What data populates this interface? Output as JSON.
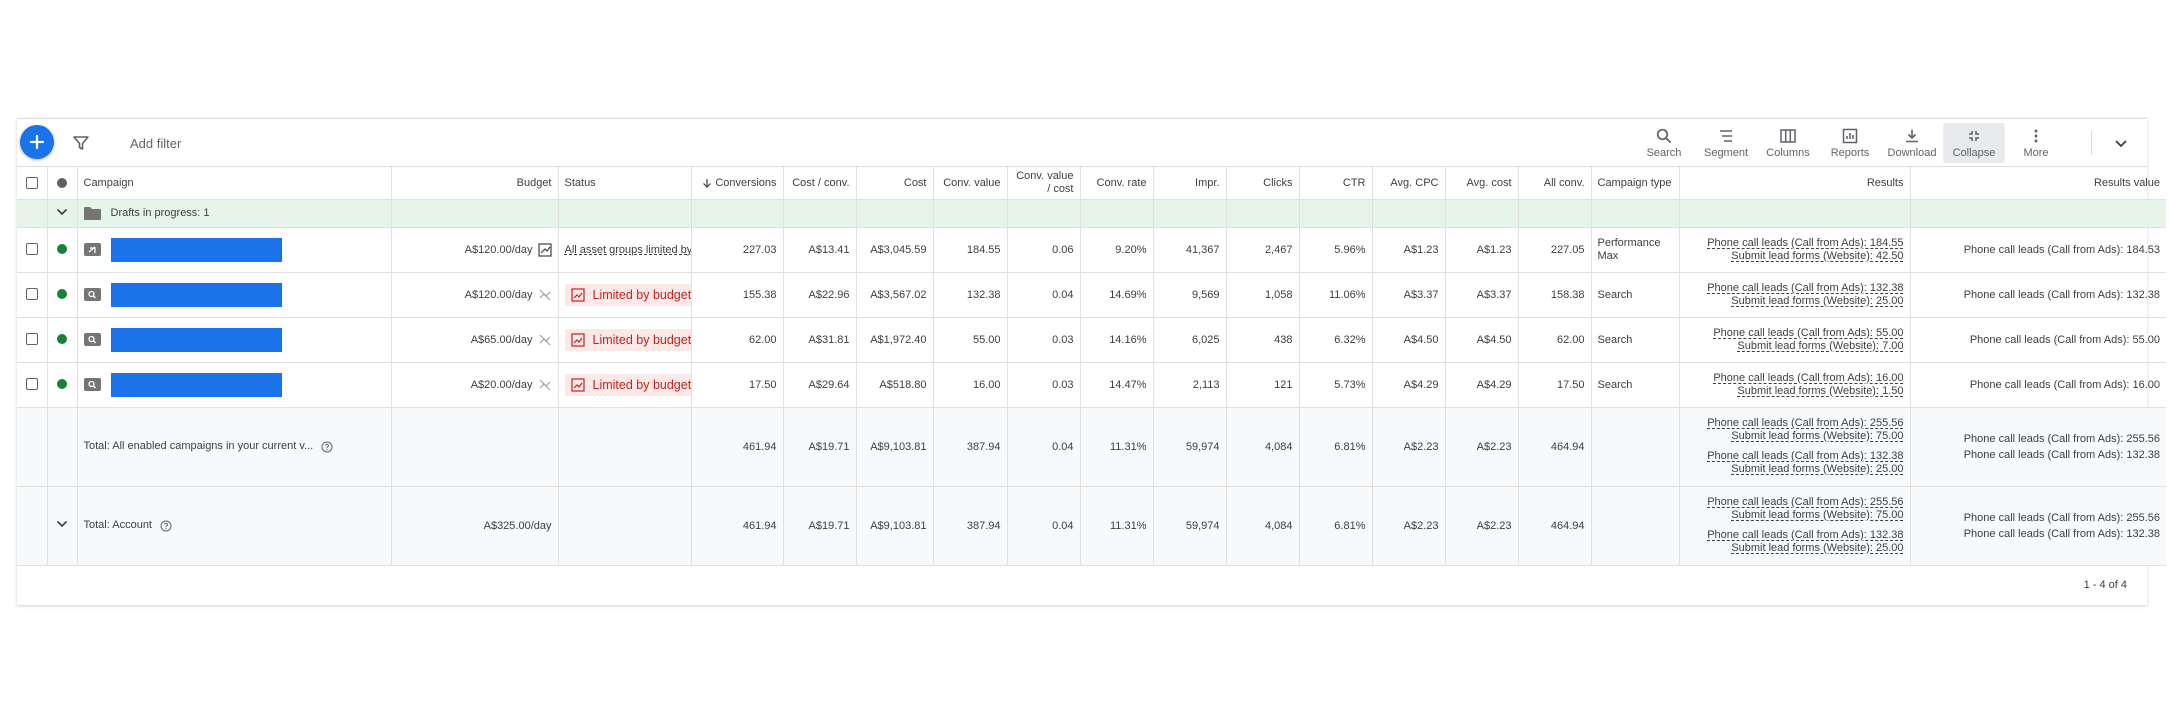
{
  "toolbar": {
    "add_filter": "Add filter",
    "tools": [
      {
        "label": "Search",
        "icon": "search-icon"
      },
      {
        "label": "Segment",
        "icon": "segment-icon"
      },
      {
        "label": "Columns",
        "icon": "columns-icon"
      },
      {
        "label": "Reports",
        "icon": "reports-icon"
      },
      {
        "label": "Download",
        "icon": "download-icon"
      },
      {
        "label": "Collapse",
        "icon": "collapse-icon"
      },
      {
        "label": "More",
        "icon": "more-vert-icon"
      }
    ]
  },
  "columns": {
    "campaign": "Campaign",
    "budget": "Budget",
    "status": "Status",
    "conversions": "Conversions",
    "cost_conv": "Cost / conv.",
    "cost": "Cost",
    "conv_value": "Conv. value",
    "conv_value_cost_1": "Conv. value",
    "conv_value_cost_2": "/ cost",
    "conv_rate": "Conv. rate",
    "impr": "Impr.",
    "clicks": "Clicks",
    "ctr": "CTR",
    "avg_cpc": "Avg. CPC",
    "avg_cost": "Avg. cost",
    "all_conv": "All conv.",
    "campaign_type": "Campaign type",
    "results": "Results",
    "results_value": "Results value"
  },
  "draft": {
    "label": "Drafts in progress: 1"
  },
  "rows": [
    {
      "budget": "A$120.00/day",
      "status": "All asset groups limited by bid strategy",
      "conversions": "227.03",
      "cost_conv": "A$13.41",
      "cost": "A$3,045.59",
      "conv_value": "184.55",
      "conv_value_cost": "0.06",
      "conv_rate": "9.20%",
      "impr": "41,367",
      "clicks": "2,467",
      "ctr": "5.96%",
      "avg_cpc": "A$1.23",
      "avg_cost": "A$1.23",
      "all_conv": "227.05",
      "type_1": "Performance",
      "type_2": "Max",
      "results_1": "Phone call leads (Call from Ads): 184.55",
      "results_2": "Submit lead forms (Website): 42.50",
      "results_value": "Phone call leads (Call from Ads): 184.53"
    },
    {
      "budget": "A$120.00/day",
      "status": "Limited by budget",
      "conversions": "155.38",
      "cost_conv": "A$22.96",
      "cost": "A$3,567.02",
      "conv_value": "132.38",
      "conv_value_cost": "0.04",
      "conv_rate": "14.69%",
      "impr": "9,569",
      "clicks": "1,058",
      "ctr": "11.06%",
      "avg_cpc": "A$3.37",
      "avg_cost": "A$3.37",
      "all_conv": "158.38",
      "type_1": "Search",
      "results_1": "Phone call leads (Call from Ads): 132.38",
      "results_2": "Submit lead forms (Website): 25.00",
      "results_value": "Phone call leads (Call from Ads): 132.38"
    },
    {
      "budget": "A$65.00/day",
      "status": "Limited by budget",
      "conversions": "62.00",
      "cost_conv": "A$31.81",
      "cost": "A$1,972.40",
      "conv_value": "55.00",
      "conv_value_cost": "0.03",
      "conv_rate": "14.16%",
      "impr": "6,025",
      "clicks": "438",
      "ctr": "6.32%",
      "avg_cpc": "A$4.50",
      "avg_cost": "A$4.50",
      "all_conv": "62.00",
      "type_1": "Search",
      "results_1": "Phone call leads (Call from Ads): 55.00",
      "results_2": "Submit lead forms (Website): 7.00",
      "results_value": "Phone call leads (Call from Ads): 55.00"
    },
    {
      "budget": "A$20.00/day",
      "status": "Limited by budget",
      "conversions": "17.50",
      "cost_conv": "A$29.64",
      "cost": "A$518.80",
      "conv_value": "16.00",
      "conv_value_cost": "0.03",
      "conv_rate": "14.47%",
      "impr": "2,113",
      "clicks": "121",
      "ctr": "5.73%",
      "avg_cpc": "A$4.29",
      "avg_cost": "A$4.29",
      "all_conv": "17.50",
      "type_1": "Search",
      "results_1": "Phone call leads (Call from Ads): 16.00",
      "results_2": "Submit lead forms (Website): 1.50",
      "results_value": "Phone call leads (Call from Ads): 16.00"
    }
  ],
  "total": {
    "label": "Total: All enabled campaigns in your current v...",
    "conversions": "461.94",
    "cost_conv": "A$19.71",
    "cost": "A$9,103.81",
    "conv_value": "387.94",
    "conv_value_cost": "0.04",
    "conv_rate": "11.31%",
    "impr": "59,974",
    "clicks": "4,084",
    "ctr": "6.81%",
    "avg_cpc": "A$2.23",
    "avg_cost": "A$2.23",
    "all_conv": "464.94",
    "results_1": "Phone call leads (Call from Ads): 255.56",
    "results_2": "Submit lead forms (Website): 75.00",
    "results_3": "Phone call leads (Call from Ads): 132.38",
    "results_4": "Submit lead forms (Website): 25.00",
    "rv_1": "Phone call leads (Call from Ads): 255.56",
    "rv_2": "Phone call leads (Call from Ads): 132.38"
  },
  "account": {
    "label": "Total: Account",
    "budget": "A$325.00/day",
    "conversions": "461.94",
    "cost_conv": "A$19.71",
    "cost": "A$9,103.81",
    "conv_value": "387.94",
    "conv_value_cost": "0.04",
    "conv_rate": "11.31%",
    "impr": "59,974",
    "clicks": "4,084",
    "ctr": "6.81%",
    "avg_cpc": "A$2.23",
    "avg_cost": "A$2.23",
    "all_conv": "464.94",
    "results_1": "Phone call leads (Call from Ads): 255.56",
    "results_2": "Submit lead forms (Website): 75.00",
    "results_3": "Phone call leads (Call from Ads): 132.38",
    "results_4": "Submit lead forms (Website): 25.00",
    "rv_1": "Phone call leads (Call from Ads): 255.56",
    "rv_2": "Phone call leads (Call from Ads): 132.38"
  },
  "pager": "1 - 4 of 4",
  "colors": {
    "accent": "#1a73e8",
    "enabled": "#188038",
    "limited_bg": "#fce8e6",
    "limited_fg": "#c5221f",
    "draft_bg": "#e6f4ea"
  }
}
